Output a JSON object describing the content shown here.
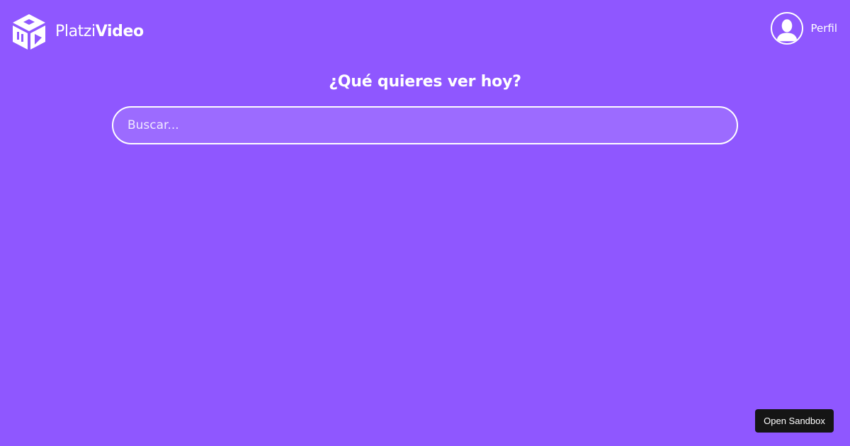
{
  "header": {
    "logo": {
      "icon": "platzi-video-logo-icon",
      "brand_light": "Platzi",
      "brand_bold": "Video"
    },
    "profile": {
      "icon": "user-avatar-icon",
      "label": "Perfil"
    }
  },
  "main": {
    "title": "¿Qué quieres ver hoy?",
    "search": {
      "placeholder": "Buscar...",
      "value": ""
    }
  },
  "overlay": {
    "sandbox_button_label": "Open Sandbox"
  },
  "colors": {
    "background": "#8f57ff",
    "text": "#ffffff",
    "button_dark": "#151515"
  }
}
